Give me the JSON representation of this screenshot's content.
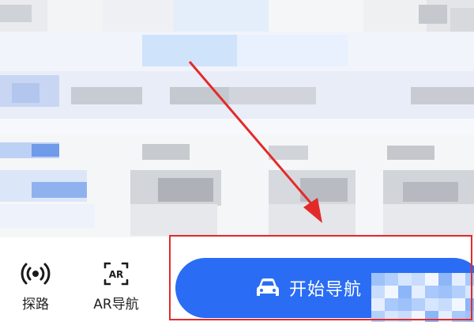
{
  "bottom_actions": [
    {
      "label": "探路",
      "icon": "explore-route-icon"
    },
    {
      "label": "AR导航",
      "icon": "ar-icon"
    }
  ],
  "start_navigation": {
    "label": "开始导航",
    "icon": "car-icon"
  },
  "ar_badge_text": "AR",
  "annotation": {
    "arrow_color": "#e32a2a",
    "box_color": "#e32a2a"
  },
  "colors": {
    "primary_button": "#2a6df4",
    "label_text": "#222222"
  }
}
